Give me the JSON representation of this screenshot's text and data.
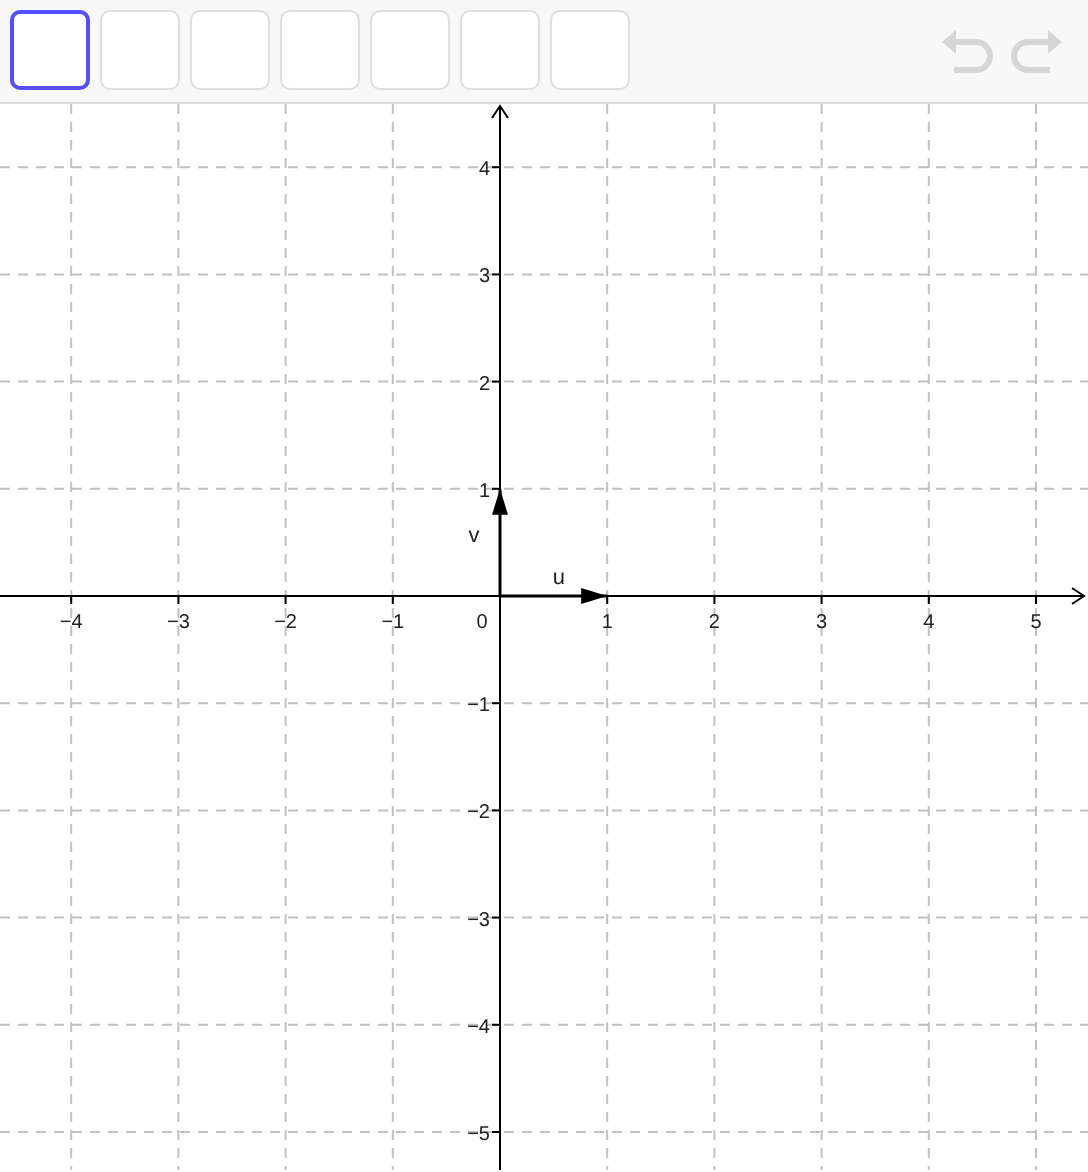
{
  "toolbar": {
    "tools": [
      {
        "selected": true
      },
      {
        "selected": false
      },
      {
        "selected": false
      },
      {
        "selected": false
      },
      {
        "selected": false
      },
      {
        "selected": false
      },
      {
        "selected": false
      }
    ],
    "undo": {
      "disabled": true
    },
    "redo": {
      "disabled": true
    }
  },
  "graphics": {
    "x_ticks": [
      "−4",
      "−3",
      "−2",
      "−1",
      "1",
      "2",
      "3",
      "4",
      "5"
    ],
    "y_ticks": [
      "4",
      "3",
      "2",
      "1",
      "−1",
      "−2",
      "−3",
      "−4",
      "−5"
    ],
    "origin_label": "0",
    "vectors": [
      {
        "label": "u",
        "kind": "horizontal"
      },
      {
        "label": "v",
        "kind": "vertical"
      }
    ]
  }
}
